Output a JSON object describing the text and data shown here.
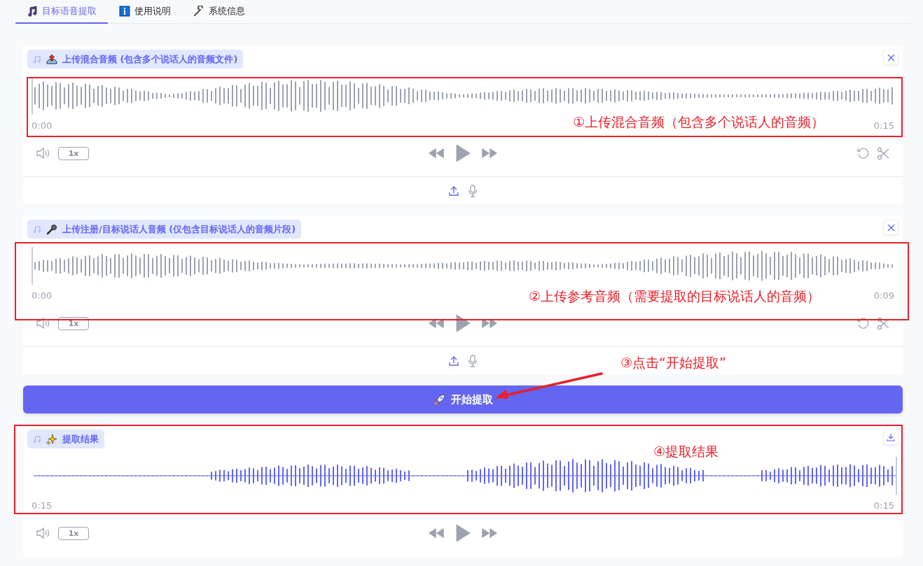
{
  "tabs": [
    {
      "label": "目标语音提取",
      "selected": true
    },
    {
      "label": "使用说明",
      "selected": false
    },
    {
      "label": "系统信息",
      "selected": false
    }
  ],
  "panels": [
    {
      "kind": "input",
      "label": "上传混合音频 (包含多个说话人的音频文件)",
      "time_start": "0:00",
      "time_end": "0:15",
      "speed": "1x",
      "annotation": "①上传混合音频（包含多个说话人的音频）"
    },
    {
      "kind": "input",
      "label": "上传注册/目标说话人音频 (仅包含目标说话人的音频片段)",
      "time_start": "0:00",
      "time_end": "0:09",
      "speed": "1x",
      "annotation": "②上传参考音频（需要提取的目标说话人的音频）"
    },
    {
      "kind": "output",
      "label": "提取结果",
      "time_start": "0:15",
      "time_end": "0:15",
      "speed": "1x",
      "annotation": "④提取结果"
    }
  ],
  "action_button": {
    "label": "开始提取",
    "annotation": "③点击“开始提取”"
  }
}
